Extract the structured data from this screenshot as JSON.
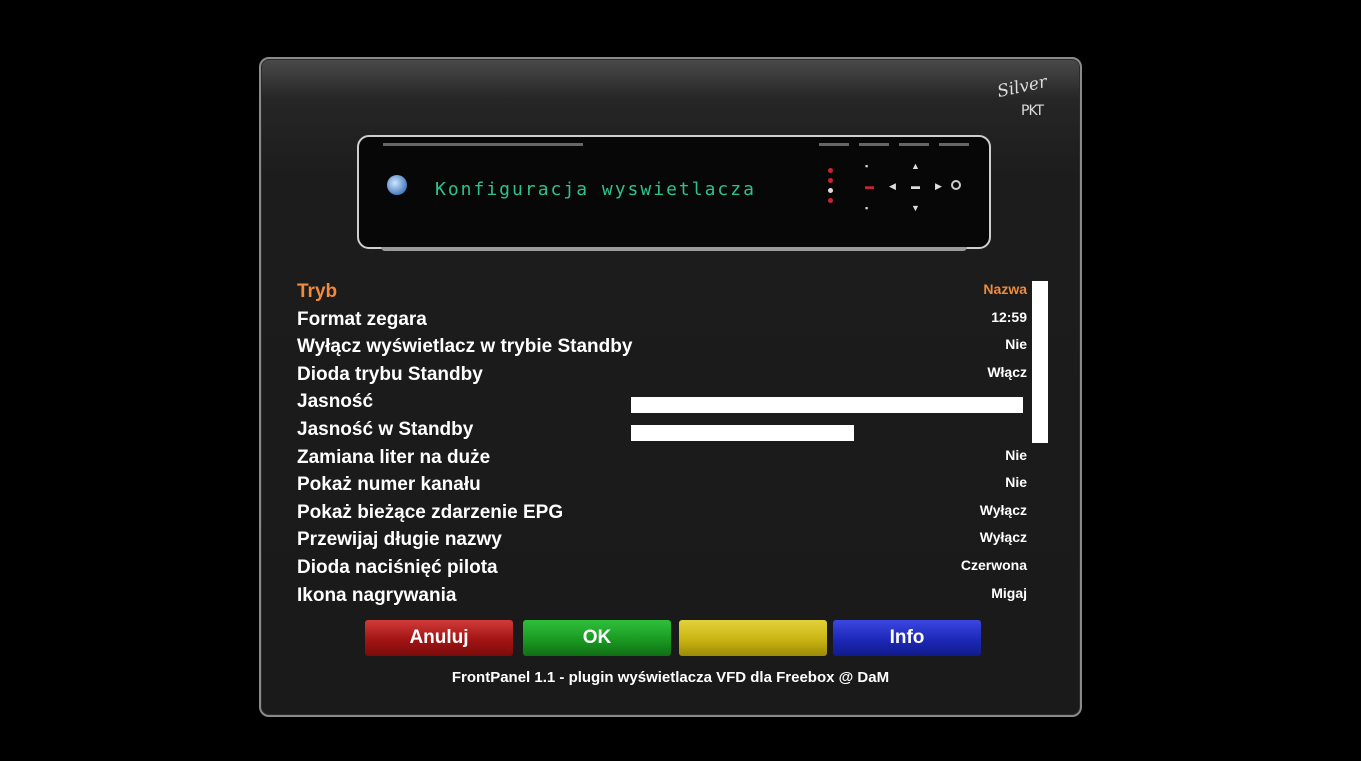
{
  "screen": {
    "background": "#000000",
    "accent_selected": "#f08a3c"
  },
  "logo": {
    "line1": "Silver",
    "line2": "PKT"
  },
  "device_display": {
    "vfd_text": "Konfiguracja wyswietlacza"
  },
  "settings": [
    {
      "label": "Tryb",
      "value": "Nazwa",
      "selected": true
    },
    {
      "label": "Format zegara",
      "value": "12:59"
    },
    {
      "label": "Wyłącz wyświetlacz w trybie Standby",
      "value": "Nie"
    },
    {
      "label": "Dioda trybu Standby",
      "value": "Włącz"
    },
    {
      "label": "Jasność",
      "value": "",
      "level": 1.0
    },
    {
      "label": "Jasność w Standby",
      "value": "",
      "level": 0.57
    },
    {
      "label": "Zamiana liter na duże",
      "value": "Nie"
    },
    {
      "label": "Pokaż numer kanału",
      "value": "Nie"
    },
    {
      "label": "Pokaż bieżące zdarzenie EPG",
      "value": "Wyłącz"
    },
    {
      "label": "Przewijaj długie nazwy",
      "value": "Wyłącz"
    },
    {
      "label": "Dioda naciśnięć pilota",
      "value": "Czerwona"
    },
    {
      "label": "Ikona nagrywania",
      "value": "Migaj"
    }
  ],
  "buttons": {
    "red": "Anuluj",
    "green": "OK",
    "yellow": "",
    "blue": "Info"
  },
  "footer": "FrontPanel 1.1 - plugin wyświetlacza VFD dla Freebox @ DaM"
}
